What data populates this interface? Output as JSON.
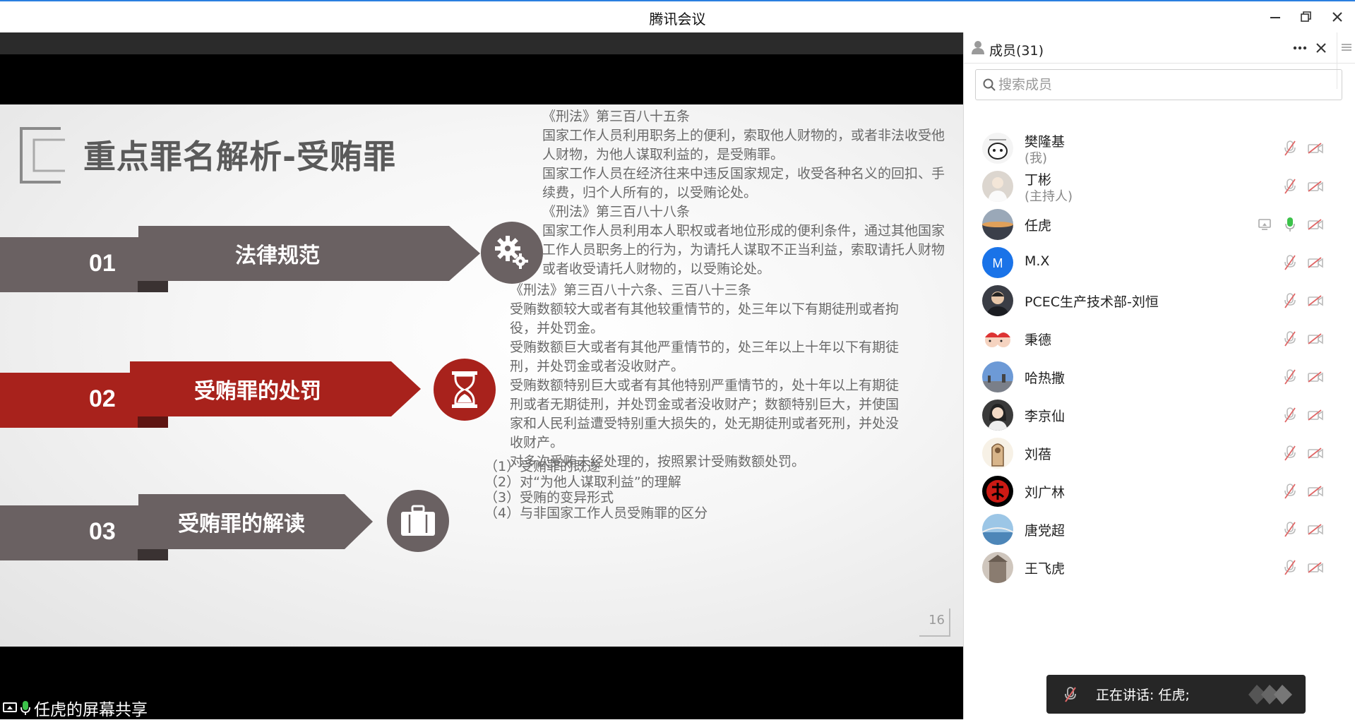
{
  "window": {
    "title": "腾讯会议"
  },
  "share": {
    "owner_label": "任虎的屏幕共享",
    "slide": {
      "title": "重点罪名解析-受贿罪",
      "page_number": "16",
      "sections": [
        {
          "number": "01",
          "label": "法律规范",
          "icon": "gears-icon"
        },
        {
          "number": "02",
          "label": "受贿罪的处罚",
          "icon": "hourglass-icon"
        },
        {
          "number": "03",
          "label": "受贿罪的解读",
          "icon": "briefcase-icon"
        }
      ],
      "text_block_1": [
        "《刑法》第三百八十五条",
        "国家工作人员利用职务上的便利，索取他人财物的，或者非法收受他",
        "人财物，为他人谋取利益的，是受贿罪。",
        "国家工作人员在经济往来中违反国家规定，收受各种名义的回扣、手",
        "续费，归个人所有的，以受贿论处。",
        "《刑法》第三百八十八条",
        "国家工作人员利用本人职权或者地位形成的便利条件，通过其他国家",
        "工作人员职务上的行为，为请托人谋取不正当利益，索取请托人财物",
        "或者收受请托人财物的，以受贿论处。"
      ],
      "text_block_2": [
        "《刑法》第三百八十六条、三百八十三条",
        "受贿数额较大或者有其他较重情节的，处三年以下有期徒刑或者拘",
        "役，并处罚金。",
        "受贿数额巨大或者有其他严重情节的，处三年以上十年以下有期徒",
        "刑，并处罚金或者没收财产。",
        "受贿数额特别巨大或者有其他特别严重情节的，处十年以上有期徒",
        "刑或者无期徒刑，并处罚金或者没收财产；数额特别巨大，并使国",
        "家和人民利益遭受特别重大损失的，处无期徒刑或者死刑，并处没",
        "收财产。",
        "对多次受贿未经处理的，按照累计受贿数额处罚。"
      ],
      "text_block_3": [
        "（1）受贿罪的既遂",
        "（2）对“为他人谋取利益”的理解",
        "（3）受贿的变异形式",
        "（4）与非国家工作人员受贿罪的区分"
      ]
    }
  },
  "members_panel": {
    "header": "成员(31)",
    "search_placeholder": "搜索成员",
    "members": [
      {
        "name": "樊隆基",
        "role": "(我)",
        "avatar": "cartoon",
        "share_icon": false,
        "mic_on": false
      },
      {
        "name": "丁彬",
        "role": "(主持人)",
        "avatar": "photo-light",
        "share_icon": false,
        "mic_on": false
      },
      {
        "name": "任虎",
        "role": "",
        "avatar": "photo-sunset",
        "share_icon": true,
        "mic_on": true
      },
      {
        "name": "M.X",
        "role": "",
        "avatar": "letter-blue",
        "avatar_letter": "M",
        "share_icon": false,
        "mic_on": false
      },
      {
        "name": "PCEC生产技术部-刘恒",
        "role": "",
        "avatar": "photo-man",
        "share_icon": false,
        "mic_on": false
      },
      {
        "name": "秉德",
        "role": "",
        "avatar": "cartoon-pair",
        "share_icon": false,
        "mic_on": false
      },
      {
        "name": "哈热撒",
        "role": "",
        "avatar": "photo-sky",
        "share_icon": false,
        "mic_on": false
      },
      {
        "name": "李京仙",
        "role": "",
        "avatar": "photo-woman",
        "share_icon": false,
        "mic_on": false
      },
      {
        "name": "刘蓓",
        "role": "",
        "avatar": "drawing",
        "share_icon": false,
        "mic_on": false
      },
      {
        "name": "刘广林",
        "role": "",
        "avatar": "red-calligraphy",
        "share_icon": false,
        "mic_on": false
      },
      {
        "name": "唐党超",
        "role": "",
        "avatar": "photo-bridge",
        "share_icon": false,
        "mic_on": false
      },
      {
        "name": "王飞虎",
        "role": "",
        "avatar": "photo-building",
        "share_icon": false,
        "mic_on": false
      }
    ]
  },
  "speaking": {
    "text": "正在讲话: 任虎;"
  },
  "colors": {
    "accent": "#2a7fe0",
    "slide_band_gray": "#6a6162",
    "slide_band_red": "#a8221c",
    "mic_active": "#3cc24a",
    "muted_red": "#e06666"
  }
}
